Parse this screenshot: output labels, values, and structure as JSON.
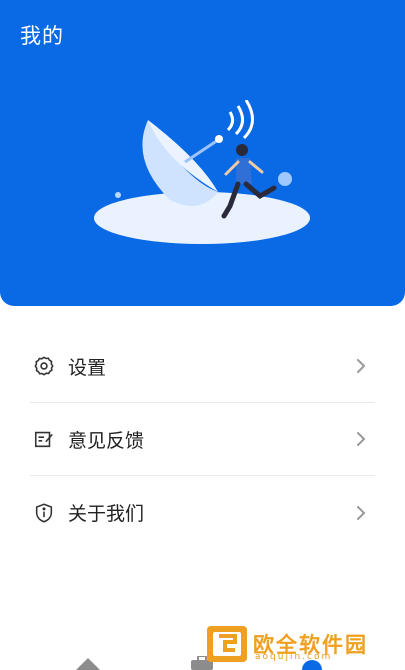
{
  "header": {
    "title": "我的",
    "background_color": "#0a6ae6"
  },
  "menu": {
    "items": [
      {
        "label": "设置",
        "icon": "gear-icon"
      },
      {
        "label": "意见反馈",
        "icon": "feedback-icon"
      },
      {
        "label": "关于我们",
        "icon": "info-shield-icon"
      }
    ]
  },
  "watermark": {
    "text": "欧全软件园",
    "url": "aoqujin.com"
  }
}
